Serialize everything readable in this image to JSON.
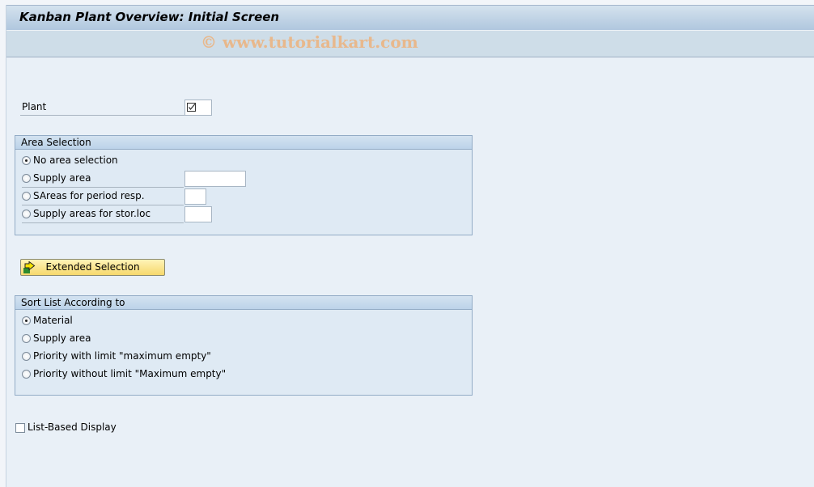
{
  "window": {
    "title": "Kanban Plant Overview: Initial Screen",
    "watermark": "© www.tutorialkart.com"
  },
  "plant": {
    "label": "Plant",
    "value": "",
    "required_icon": "required-check-icon"
  },
  "area_selection": {
    "title": "Area Selection",
    "options": [
      {
        "label": "No area selection",
        "selected": true
      },
      {
        "label": "Supply area",
        "selected": false,
        "input_value": ""
      },
      {
        "label": "SAreas for period resp.",
        "selected": false,
        "input_value": ""
      },
      {
        "label": "Supply areas for stor.loc",
        "selected": false,
        "input_value": ""
      }
    ]
  },
  "extended_selection": {
    "label": "Extended Selection",
    "icon": "execute-arrow-icon"
  },
  "sort_list": {
    "title": "Sort List According to",
    "options": [
      {
        "label": "Material",
        "selected": true
      },
      {
        "label": "Supply area",
        "selected": false
      },
      {
        "label": "Priority with limit \"maximum empty\"",
        "selected": false
      },
      {
        "label": "Priority without limit \"Maximum empty\"",
        "selected": false
      }
    ]
  },
  "list_based_display": {
    "label": "List-Based Display",
    "checked": false
  }
}
